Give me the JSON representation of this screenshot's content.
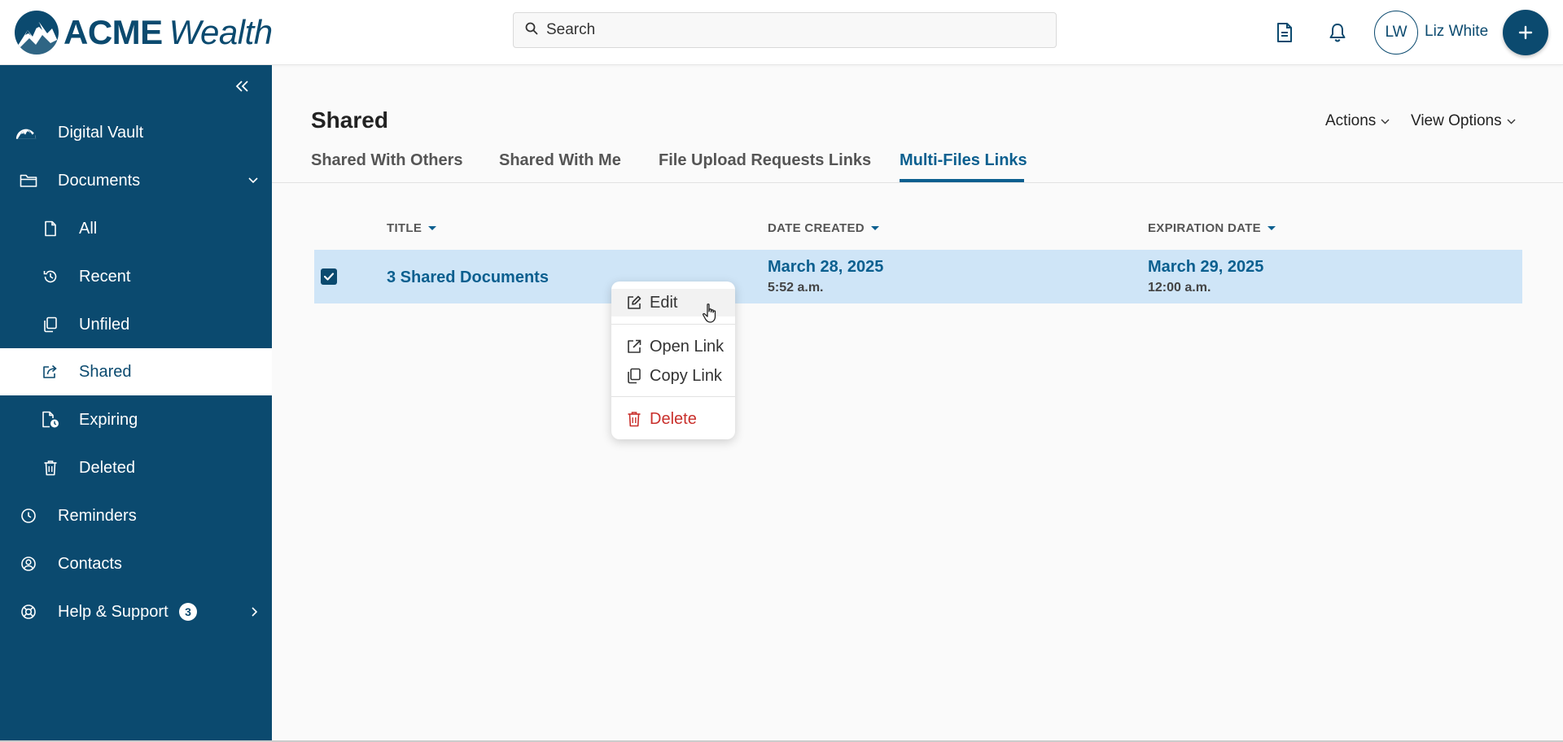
{
  "brand": {
    "name_bold": "ACME",
    "name_italic": "Wealth"
  },
  "search": {
    "placeholder": "Search"
  },
  "user": {
    "initials": "LW",
    "name": "Liz White"
  },
  "sidebar": {
    "items": [
      {
        "label": "Digital Vault",
        "icon": "mountain-logo-icon"
      },
      {
        "label": "Documents",
        "icon": "folder-icon"
      },
      {
        "label": "All",
        "icon": "file-icon"
      },
      {
        "label": "Recent",
        "icon": "history-icon"
      },
      {
        "label": "Unfiled",
        "icon": "copy-icon"
      },
      {
        "label": "Shared",
        "icon": "share-icon"
      },
      {
        "label": "Expiring",
        "icon": "file-clock-icon"
      },
      {
        "label": "Deleted",
        "icon": "trash-icon"
      },
      {
        "label": "Reminders",
        "icon": "clock-icon"
      },
      {
        "label": "Contacts",
        "icon": "user-circle-icon"
      },
      {
        "label": "Help & Support",
        "icon": "lifebuoy-icon",
        "badge": "3"
      }
    ]
  },
  "main": {
    "title": "Shared",
    "actions_label": "Actions",
    "view_options_label": "View Options",
    "tabs": [
      {
        "label": "Shared With Others"
      },
      {
        "label": "Shared With Me"
      },
      {
        "label": "File Upload Requests Links"
      },
      {
        "label": "Multi-Files Links"
      }
    ],
    "columns": {
      "title": "TITLE",
      "date_created": "DATE CREATED",
      "expiration_date": "EXPIRATION DATE"
    },
    "rows": [
      {
        "title": "3 Shared Documents",
        "date_created": "March 28, 2025",
        "time_created": "5:52 a.m.",
        "expiration_date": "March 29, 2025",
        "expiration_time": "12:00 a.m."
      }
    ]
  },
  "context_menu": {
    "edit": "Edit",
    "open_link": "Open Link",
    "copy_link": "Copy Link",
    "delete": "Delete"
  },
  "colors": {
    "primary": "#0b4a6f",
    "link": "#0b5f8f",
    "row_selected": "#cfe5f7",
    "danger": "#c9302c"
  }
}
